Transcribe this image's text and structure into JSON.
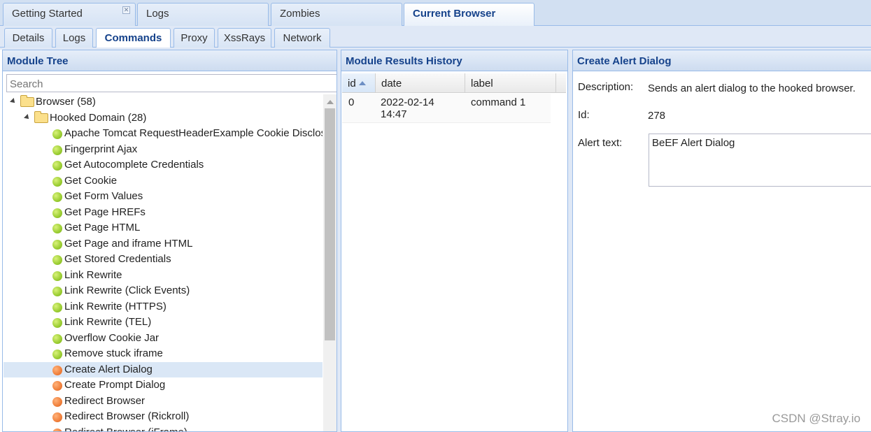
{
  "top_tabs": [
    {
      "label": "Getting Started",
      "closable": true,
      "active": false
    },
    {
      "label": "Logs",
      "active": false
    },
    {
      "label": "Zombies",
      "active": false
    },
    {
      "label": "Current Browser",
      "active": true
    }
  ],
  "sub_tabs": [
    {
      "label": "Details",
      "active": false
    },
    {
      "label": "Logs",
      "active": false
    },
    {
      "label": "Commands",
      "active": true
    },
    {
      "label": "Proxy",
      "active": false
    },
    {
      "label": "XssRays",
      "active": false
    },
    {
      "label": "Network",
      "active": false
    }
  ],
  "module_tree": {
    "title": "Module Tree",
    "search_placeholder": "Search",
    "root": {
      "label": "Browser (58)",
      "icon": "folder-icon"
    },
    "group": {
      "label": "Hooked Domain (28)",
      "icon": "folder-icon"
    },
    "modules": [
      {
        "label": "Apache Tomcat RequestHeaderExample Cookie Disclosure",
        "status": "green"
      },
      {
        "label": "Fingerprint Ajax",
        "status": "green"
      },
      {
        "label": "Get Autocomplete Credentials",
        "status": "green"
      },
      {
        "label": "Get Cookie",
        "status": "green"
      },
      {
        "label": "Get Form Values",
        "status": "green"
      },
      {
        "label": "Get Page HREFs",
        "status": "green"
      },
      {
        "label": "Get Page HTML",
        "status": "green"
      },
      {
        "label": "Get Page and iframe HTML",
        "status": "green"
      },
      {
        "label": "Get Stored Credentials",
        "status": "green"
      },
      {
        "label": "Link Rewrite",
        "status": "green"
      },
      {
        "label": "Link Rewrite (Click Events)",
        "status": "green"
      },
      {
        "label": "Link Rewrite (HTTPS)",
        "status": "green"
      },
      {
        "label": "Link Rewrite (TEL)",
        "status": "green"
      },
      {
        "label": "Overflow Cookie Jar",
        "status": "green"
      },
      {
        "label": "Remove stuck iframe",
        "status": "green"
      },
      {
        "label": "Create Alert Dialog",
        "status": "orange",
        "selected": true
      },
      {
        "label": "Create Prompt Dialog",
        "status": "orange"
      },
      {
        "label": "Redirect Browser",
        "status": "orange"
      },
      {
        "label": "Redirect Browser (Rickroll)",
        "status": "orange"
      },
      {
        "label": "Redirect Browser (iFrame)",
        "status": "orange"
      }
    ]
  },
  "results": {
    "title": "Module Results History",
    "columns": [
      "id",
      "date",
      "label"
    ],
    "rows": [
      {
        "id": "0",
        "date": "2022-02-14 14:47",
        "label": "command 1"
      }
    ]
  },
  "details": {
    "title": "Create Alert Dialog",
    "description_label": "Description:",
    "description": "Sends an alert dialog to the hooked browser.",
    "id_label": "Id:",
    "id": "278",
    "alert_label": "Alert text:",
    "alert_value": "BeEF Alert Dialog"
  },
  "colors": {
    "header_text": "#15428b",
    "status_green": "#9acd32",
    "status_orange": "#f0803c",
    "selected_row": "#dae7f6"
  },
  "watermark": "CSDN @Stray.io"
}
